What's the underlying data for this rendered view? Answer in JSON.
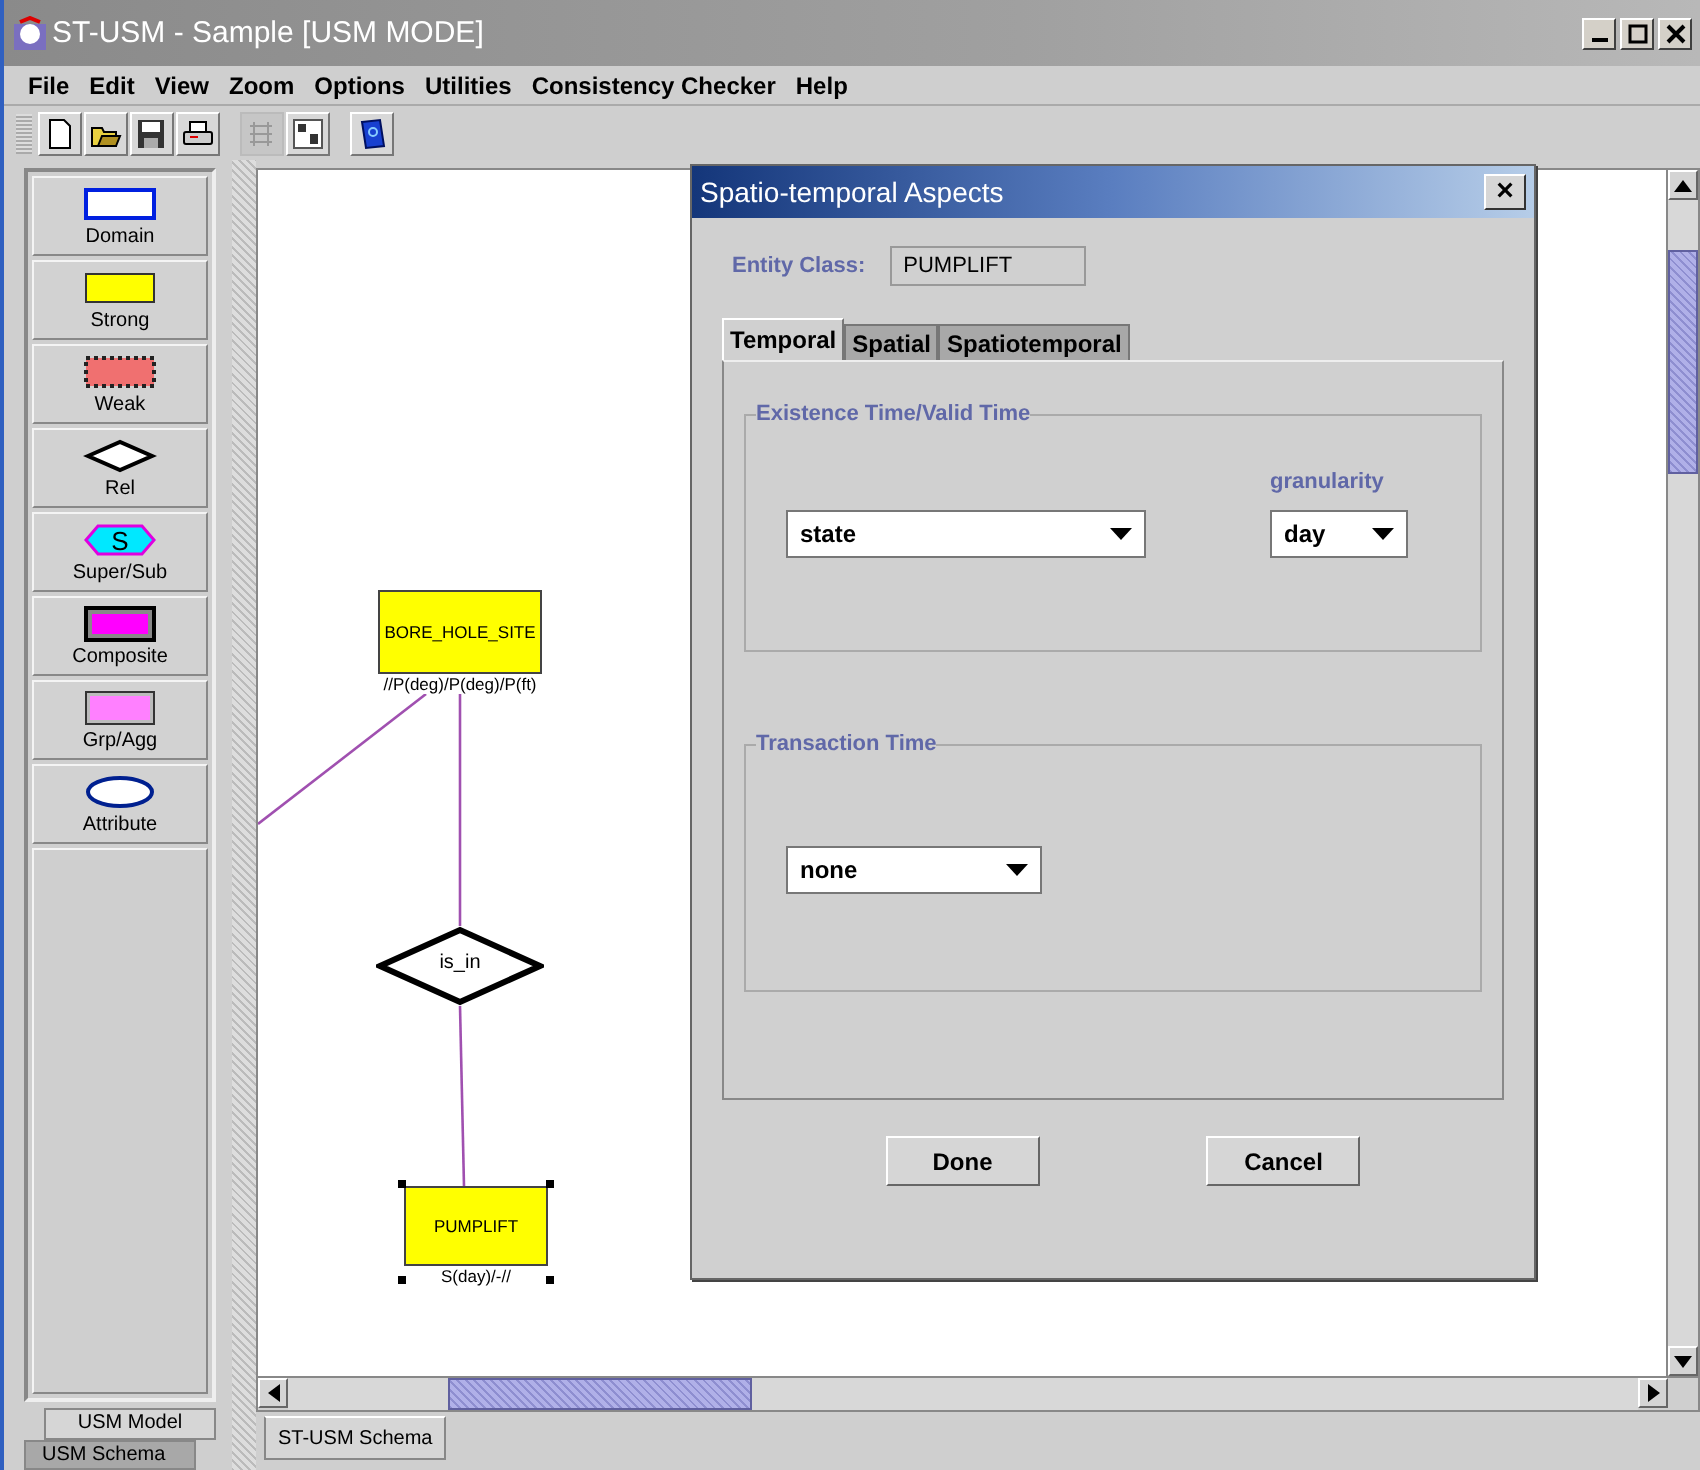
{
  "window": {
    "title": "ST-USM - Sample  [USM MODE]"
  },
  "menu": [
    "File",
    "Edit",
    "View",
    "Zoom",
    "Options",
    "Utilities",
    "Consistency Checker",
    "Help"
  ],
  "toolbar": [
    {
      "kind": "new",
      "disabled": false
    },
    {
      "kind": "open",
      "disabled": false
    },
    {
      "kind": "save",
      "disabled": false
    },
    {
      "kind": "print",
      "disabled": false
    },
    {
      "kind": "align",
      "disabled": true
    },
    {
      "kind": "layout",
      "disabled": false
    },
    {
      "kind": "help",
      "disabled": false
    }
  ],
  "palette": [
    {
      "kind": "domain",
      "label": "Domain"
    },
    {
      "kind": "strong",
      "label": "Strong"
    },
    {
      "kind": "weak",
      "label": "Weak"
    },
    {
      "kind": "rel",
      "label": "Rel"
    },
    {
      "kind": "supersub",
      "label": "Super/Sub",
      "glyph": "S"
    },
    {
      "kind": "composite",
      "label": "Composite"
    },
    {
      "kind": "grpagg",
      "label": "Grp/Agg"
    },
    {
      "kind": "attribute",
      "label": "Attribute"
    }
  ],
  "left_tabs": [
    {
      "label": "USM Model",
      "selected": true
    },
    {
      "label": "USM Schema",
      "selected": false
    }
  ],
  "diagram": {
    "nodes": [
      {
        "kind": "entity",
        "label": "BORE_HOLE_SITE",
        "annotation": "//P(deg)/P(deg)/P(ft)",
        "selected": false
      },
      {
        "kind": "relationship",
        "label": "is_in",
        "selected": false
      },
      {
        "kind": "entity",
        "label": "PUMPLIFT",
        "annotation": "S(day)/-//",
        "selected": true
      }
    ]
  },
  "bottom_tabs": [
    {
      "label": "ST-USM Schema"
    }
  ],
  "dialog": {
    "title": "Spatio-temporal Aspects",
    "close": "×",
    "entity_class_label": "Entity Class:",
    "entity_class": "PUMPLIFT",
    "tabs": [
      {
        "label": "Temporal",
        "selected": true
      },
      {
        "label": "Spatial",
        "selected": false
      },
      {
        "label": "Spatiotemporal",
        "selected": false
      }
    ],
    "existence": {
      "title": "Existence Time/Valid Time",
      "value": "state",
      "granularity_label": "granularity",
      "granularity": "day"
    },
    "transaction": {
      "title": "Transaction Time",
      "value": "none"
    },
    "buttons": [
      "Done",
      "Cancel"
    ]
  }
}
